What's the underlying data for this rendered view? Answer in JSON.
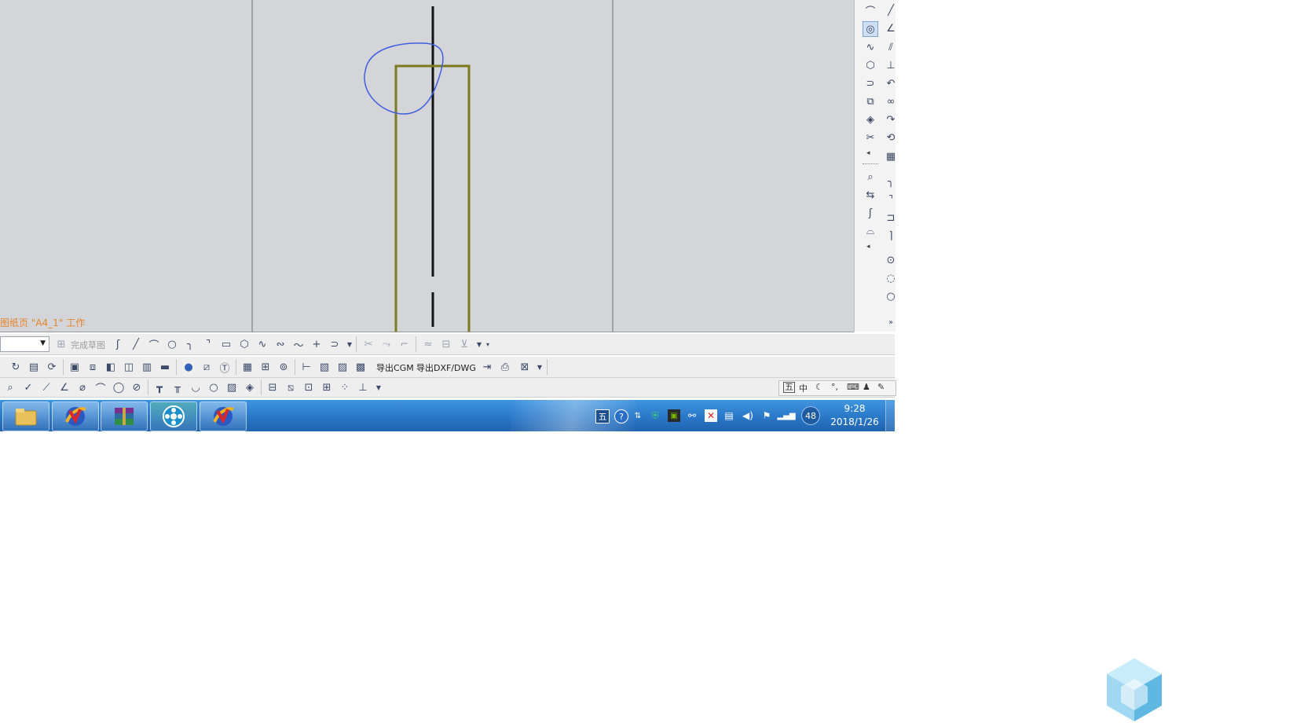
{
  "canvas": {
    "status_text": "图纸页 \"A4_1\" 工作",
    "colors": {
      "background": "#d4d5d8",
      "border_lines": "#6f6f6f",
      "centerline": "#111111",
      "part_outline": "#7b7a1f",
      "sketch_circle": "#3d5fe0"
    }
  },
  "vertical_toolbar": {
    "col1_icons": [
      "arc-icon",
      "circle-3pt-icon",
      "spline-icon",
      "hexagon-icon",
      "offset-curve-icon",
      "extrude-icon",
      "revolve-icon",
      "trim-icon",
      "more-arrow-icon",
      "measure-icon",
      "split-icon",
      "joint-icon",
      "bridge-icon",
      "more-arrow-icon"
    ],
    "col2_icons": [
      "line-icon",
      "angle-line-icon",
      "parallel-line-icon",
      "perpendicular-icon",
      "fillet-curve-icon",
      "chain-icon",
      "tangent-arc-icon",
      "tangent-circle-icon",
      "grid-icon",
      "fillet-icon",
      "chamfer-icon",
      "corner-icon",
      "corner-trim-icon",
      "circle-center-icon",
      "circle-tangent-icon",
      "circle-3pt-icon",
      "expand-icon"
    ]
  },
  "toolbar1": {
    "finish_sketch_label": "完成草图",
    "icons": [
      "profile-icon",
      "line-icon",
      "arc-icon",
      "circle-icon",
      "fillet-icon",
      "chamfer-icon",
      "rectangle-icon",
      "polygon-icon",
      "studio-spline-icon",
      "fit-spline-icon",
      "curve-icon",
      "point-icon",
      "offset-icon",
      "trim-icon",
      "extend-icon",
      "corner-icon",
      "make-symmetric-icon",
      "constraint-icon",
      "display-constraints-icon"
    ]
  },
  "toolbar2": {
    "export_cgm_label": "导出CGM",
    "export_dxf_label": "导出DXF/DWG",
    "icons": [
      "refresh-icon",
      "open-sheet-icon",
      "update-icon",
      "view-icon",
      "base-view-icon",
      "projected-view-icon",
      "detail-view-icon",
      "section-view-icon",
      "break-view-icon",
      "sphere-icon",
      "slash-icon",
      "text-box-icon",
      "table-icon",
      "insert-table-icon",
      "symbol-icon",
      "dimension-icon",
      "note-icon",
      "balloon-icon",
      "image-icon",
      "export-arrow-icon",
      "print-icon",
      "close-box-icon"
    ]
  },
  "toolbar3": {
    "icons": [
      "zoom-window-icon",
      "check-icon",
      "measure-distance-icon",
      "measure-angle-icon",
      "measure-radius-icon",
      "measure-arc-icon",
      "circle-measure-icon",
      "link-icon",
      "column-icon",
      "table-column-icon",
      "cylinder-icon",
      "circle-icon",
      "hatch-icon",
      "diamond-icon",
      "datum-icon",
      "datum-feature-icon",
      "frame-icon",
      "ordinate-icon",
      "grid-dots-icon",
      "coordinate-icon"
    ],
    "ime_icons": [
      "wubi-icon",
      "chinese-mode-icon",
      "half-width-moon-icon",
      "punctuation-icon",
      "keyboard-icon",
      "user-icon",
      "wrench-icon"
    ],
    "ime_labels": {
      "wubi": "五",
      "chinese": "中"
    }
  },
  "taskbar": {
    "buttons": [
      "file-explorer-icon",
      "nx-app-icon",
      "winrar-icon",
      "media-player-icon",
      "nx-app-icon"
    ],
    "tray_icons": [
      "wubi-tray-icon",
      "help-icon",
      "expand-tray-icon",
      "shield-icon",
      "nvidia-icon",
      "network-adapter-icon",
      "close-red-icon",
      "clipboard-icon",
      "speaker-icon",
      "flag-icon",
      "signal-icon",
      "speedometer-icon"
    ],
    "tray_labels": {
      "wubi": "五",
      "help": "?",
      "speed": "48"
    },
    "time": "9:28",
    "date": "2018/1/26"
  }
}
